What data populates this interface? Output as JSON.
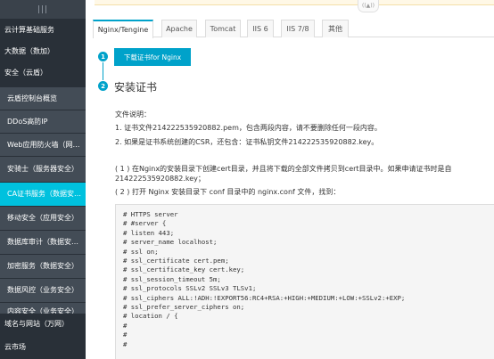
{
  "sidebar": {
    "grip": "|||",
    "items": [
      {
        "label": "云计算基础服务",
        "kind": "cat"
      },
      {
        "label": "大数据（数加）",
        "kind": "cat"
      },
      {
        "label": "安全（云盾）",
        "kind": "cat"
      },
      {
        "label": "云盾控制台概览",
        "kind": "sub"
      },
      {
        "label": "DDoS高防IP",
        "kind": "sub"
      },
      {
        "label": "Web应用防火墙（网…",
        "kind": "sub"
      },
      {
        "label": "安骑士（服务器安全）",
        "kind": "sub"
      },
      {
        "label": "CA证书服务（数据安…",
        "kind": "sub active"
      },
      {
        "label": "移动安全（应用安全）",
        "kind": "sub"
      },
      {
        "label": "数据库审计（数据安…",
        "kind": "sub"
      },
      {
        "label": "加密服务（数据安全）",
        "kind": "sub"
      },
      {
        "label": "数据风控（业务安全）",
        "kind": "sub"
      },
      {
        "label": "内容安全（业务安全）",
        "kind": "sub"
      },
      {
        "label": "域名与网站（万网）",
        "kind": "cat"
      },
      {
        "label": "云市场",
        "kind": "cat"
      }
    ]
  },
  "tabs": [
    "Nginx/Tengine",
    "Apache",
    "Tomcat",
    "IIS 6",
    "IIS 7/8",
    "其他"
  ],
  "steps": {
    "step1_number": "1",
    "download_button": "下载证书for Nginx",
    "step2_number": "2",
    "step2_title": "安装证书"
  },
  "content": {
    "file_desc_label": "文件说明：",
    "file_desc_1": "1. 证书文件214222535920882.pem，包含两段内容，请不要删除任何一段内容。",
    "file_desc_2": "2. 如果是证书系统创建的CSR，还包含：证书私钥文件214222535920882.key。",
    "instr_1a": "( 1 ) 在Nginx的安装目录下创建cert目录，并且将下载的全部文件拷贝到cert目录中。如果申请证书时是自",
    "instr_1b": "214222535920882.key；",
    "instr_2": "( 2 ) 打开 Nginx 安装目录下 conf 目录中的 nginx.conf 文件，找到："
  },
  "code_lines": [
    "# HTTPS server",
    "# #server {",
    "# listen 443;",
    "# server_name localhost;",
    "# ssl on;",
    "# ssl_certificate cert.pem;",
    "# ssl_certificate_key cert.key;",
    "# ssl_session_timeout 5m;",
    "# ssl_protocols SSLv2 SSLv3 TLSv1;",
    "# ssl_ciphers ALL:!ADH:!EXPORT56:RC4+RSA:+HIGH:+MEDIUM:+LOW:+SSLv2:+EXP;",
    "# ssl_prefer_server_ciphers on;",
    "# location / {",
    "#",
    "#",
    "#"
  ],
  "colors": {
    "sidebar_bg": "#293038",
    "active_bg": "#00c1de",
    "accent": "#00a2ca"
  },
  "notice_icon": "sound-icon"
}
